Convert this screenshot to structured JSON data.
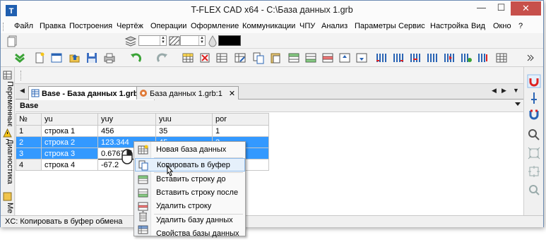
{
  "window": {
    "title": "T-FLEX CAD x64 - C:\\База данных 1.grb",
    "minimize_glyph": "—",
    "maximize_glyph": "☐",
    "close_glyph": "✕"
  },
  "menu": {
    "items": [
      "Файл",
      "Правка",
      "Построения",
      "Чертёж",
      "Операции",
      "Оформление",
      "Коммуникации",
      "ЧПУ",
      "Анализ",
      "Параметры",
      "Сервис",
      "Настройка",
      "Вид",
      "Окно",
      "?"
    ]
  },
  "left_tabs": [
    "Переменные",
    "Диагностика",
    "Мен"
  ],
  "doc_tabs": [
    {
      "label": "Base - База данных 1.grb",
      "close": "✕",
      "active": true
    },
    {
      "label": "База данных 1.grb:1",
      "close": "✕",
      "active": false
    }
  ],
  "tab_nav": {
    "left": "◀",
    "right": "▶",
    "menu": "▼"
  },
  "grid": {
    "name": "Base",
    "headers": [
      "№",
      "yu",
      "yuy",
      "yuu",
      "por"
    ],
    "rows": [
      [
        "1",
        "строка 1",
        "456",
        "35",
        "1"
      ],
      [
        "2",
        "строка 2",
        "123.344",
        "45",
        "2"
      ],
      [
        "3",
        "строка 3",
        "0.6767",
        "",
        ""
      ],
      [
        "4",
        "строка 4",
        "-67.2",
        "",
        ""
      ]
    ],
    "selected_rows": [
      1,
      2
    ]
  },
  "context_menu": {
    "items": [
      {
        "label": "Новая база данных",
        "icon": "new-database-icon"
      },
      {
        "label": "Копировать в буфер",
        "icon": "copy-icon",
        "hover": true
      },
      {
        "label": "Вставить строку до",
        "icon": "insert-row-before-icon"
      },
      {
        "label": "Вставить строку после",
        "icon": "insert-row-after-icon"
      },
      {
        "label": "Удалить строку",
        "icon": "delete-row-icon"
      },
      {
        "label": "Удалить базу данных",
        "icon": "delete-database-icon"
      },
      {
        "label": "Свойства базы данных",
        "icon": "database-properties-icon"
      }
    ]
  },
  "status": {
    "text": "XC: Копировать в буфер обмена"
  },
  "colors": {
    "selection": "#3399ff",
    "close_button": "#c7504b",
    "accent_green": "#3aa336"
  }
}
